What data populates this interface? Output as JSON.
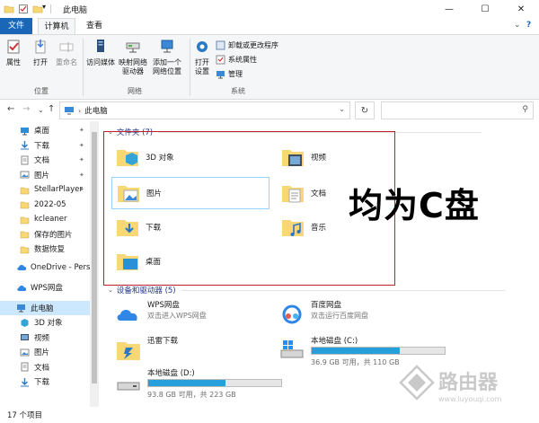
{
  "window": {
    "title": "此电脑",
    "minimize": "—",
    "maximize": "☐",
    "close": "✕"
  },
  "tabs": [
    {
      "label": "文件"
    },
    {
      "label": "计算机"
    },
    {
      "label": "查看"
    }
  ],
  "ribbon": {
    "location": {
      "label": "位置",
      "items": [
        "属性",
        "打开",
        "重命名"
      ]
    },
    "network": {
      "label": "网络",
      "items": [
        "访问媒体",
        "映射网络\n驱动器",
        "添加一个\n网络位置"
      ]
    },
    "system": {
      "label": "系统",
      "open_settings": "打开\n设置",
      "uninstall": "卸载或更改程序",
      "sys_props": "系统属性",
      "manage": "管理"
    }
  },
  "address": {
    "path": "此电脑",
    "search_placeholder": ""
  },
  "nav_pane": {
    "items": [
      {
        "label": "桌面",
        "icon": "desktop-icon",
        "pinned": true
      },
      {
        "label": "下载",
        "icon": "download-icon",
        "pinned": true
      },
      {
        "label": "文档",
        "icon": "document-icon",
        "pinned": true
      },
      {
        "label": "图片",
        "icon": "picture-icon",
        "pinned": true
      },
      {
        "label": "StellarPlayer",
        "icon": "folder-icon",
        "pinned": true
      },
      {
        "label": "2022-05",
        "icon": "folder-icon"
      },
      {
        "label": "kcleaner",
        "icon": "folder-icon"
      },
      {
        "label": "保存的图片",
        "icon": "folder-icon"
      },
      {
        "label": "数据恢复",
        "icon": "folder-icon"
      },
      {
        "label": "OneDrive - Perso",
        "icon": "cloud-icon"
      },
      {
        "label": "WPS网盘",
        "icon": "cloud-icon"
      },
      {
        "label": "此电脑",
        "icon": "computer-icon",
        "selected": true
      },
      {
        "label": "3D 对象",
        "icon": "3d-objects-icon"
      },
      {
        "label": "视频",
        "icon": "video-icon"
      },
      {
        "label": "图片",
        "icon": "picture-icon"
      },
      {
        "label": "文档",
        "icon": "document-icon"
      },
      {
        "label": "下载",
        "icon": "download-icon"
      }
    ]
  },
  "folders": {
    "header": "文件夹 (7)",
    "items": [
      {
        "label": "3D 对象"
      },
      {
        "label": "视频"
      },
      {
        "label": "图片"
      },
      {
        "label": "文档"
      },
      {
        "label": "下载"
      },
      {
        "label": "音乐"
      },
      {
        "label": "桌面"
      }
    ]
  },
  "devices": {
    "header": "设备和驱动器 (5)",
    "items": [
      {
        "name": "WPS网盘",
        "sub": "双击进入WPS网盘"
      },
      {
        "name": "百度网盘",
        "sub": "双击运行百度网盘"
      },
      {
        "name": "迅雷下载",
        "sub": ""
      },
      {
        "name": "本地磁盘 (C:)",
        "capacity": "36.9 GB 可用，共 110 GB",
        "used_fraction": 0.66
      },
      {
        "name": "本地磁盘 (D:)",
        "capacity": "93.8 GB 可用，共 223 GB",
        "used_fraction": 0.58
      }
    ]
  },
  "overlay": {
    "text": "均为C盘"
  },
  "status": {
    "count": "17 个项目"
  },
  "watermark": {
    "text": "路由器",
    "url": "www.luyouqi.com"
  },
  "colors": {
    "accent": "#1a66b7",
    "highlight": "#c0202c",
    "drive_bar": "#26a0da"
  }
}
